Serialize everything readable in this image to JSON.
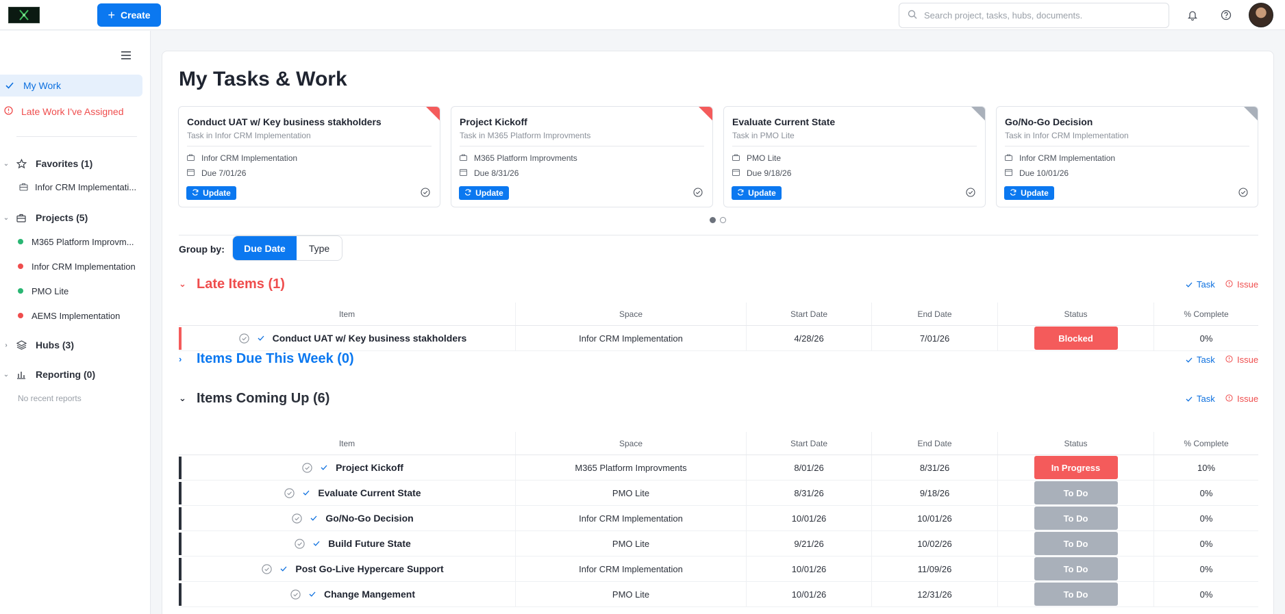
{
  "header": {
    "create_label": "Create",
    "search_placeholder": "Search project, tasks, hubs, documents."
  },
  "sidebar": {
    "my_work": "My Work",
    "late_assigned": "Late Work I've Assigned",
    "favorites": "Favorites (1)",
    "favorite_items": [
      "Infor CRM Implementati..."
    ],
    "projects": "Projects (5)",
    "project_items": [
      {
        "label": "M365 Platform Improvm...",
        "color": "#2ab673"
      },
      {
        "label": "Infor CRM Implementation",
        "color": "#ef4d4d"
      },
      {
        "label": "PMO Lite",
        "color": "#2ab673"
      },
      {
        "label": "AEMS Implementation",
        "color": "#ef4d4d"
      }
    ],
    "hubs": "Hubs (3)",
    "reporting": "Reporting (0)",
    "no_reports": "No recent reports"
  },
  "main": {
    "title": "My Tasks & Work",
    "cards": [
      {
        "title": "Conduct UAT w/ Key business stakholders",
        "subtitle": "Task in Infor CRM Implementation",
        "project": "Infor CRM Implementation",
        "due": "Due 7/01/26",
        "update": "Update",
        "corner": "#f45b5b"
      },
      {
        "title": "Project Kickoff",
        "subtitle": "Task in M365 Platform Improvments",
        "project": "M365 Platform Improvments",
        "due": "Due 8/31/26",
        "update": "Update",
        "corner": "#f45b5b"
      },
      {
        "title": "Evaluate Current State",
        "subtitle": "Task in PMO Lite",
        "project": "PMO Lite",
        "due": "Due 9/18/26",
        "update": "Update",
        "corner": "#a9b0ba"
      },
      {
        "title": "Go/No-Go Decision",
        "subtitle": "Task in Infor CRM Implementation",
        "project": "Infor CRM Implementation",
        "due": "Due 10/01/26",
        "update": "Update",
        "corner": "#a9b0ba"
      }
    ],
    "group_by_label": "Group by:",
    "group_options": [
      "Due Date",
      "Type"
    ],
    "columns": [
      "Item",
      "Space",
      "Start Date",
      "End Date",
      "Status",
      "% Complete"
    ],
    "task_label": "Task",
    "issue_label": "Issue",
    "groups": {
      "late": {
        "title": "Late Items (1)",
        "rows": [
          {
            "item": "Conduct UAT w/ Key business stakholders",
            "space": "Infor CRM Implementation",
            "start": "4/28/26",
            "end": "7/01/26",
            "status": "Blocked",
            "status_color": "#f45b5b",
            "pct": "0%"
          }
        ]
      },
      "week": {
        "title": "Items Due This Week (0)"
      },
      "upcoming": {
        "title": "Items Coming Up (6)",
        "rows": [
          {
            "item": "Project Kickoff",
            "space": "M365 Platform Improvments",
            "start": "8/01/26",
            "end": "8/31/26",
            "status": "In Progress",
            "status_color": "#f45b5b",
            "pct": "10%"
          },
          {
            "item": "Evaluate Current State",
            "space": "PMO Lite",
            "start": "8/31/26",
            "end": "9/18/26",
            "status": "To Do",
            "status_color": "#a9b0ba",
            "pct": "0%"
          },
          {
            "item": "Go/No-Go Decision",
            "space": "Infor CRM Implementation",
            "start": "10/01/26",
            "end": "10/01/26",
            "status": "To Do",
            "status_color": "#a9b0ba",
            "pct": "0%"
          },
          {
            "item": "Build Future State",
            "space": "PMO Lite",
            "start": "9/21/26",
            "end": "10/02/26",
            "status": "To Do",
            "status_color": "#a9b0ba",
            "pct": "0%"
          },
          {
            "item": "Post Go-Live Hypercare Support",
            "space": "Infor CRM Implementation",
            "start": "10/01/26",
            "end": "11/09/26",
            "status": "To Do",
            "status_color": "#a9b0ba",
            "pct": "0%"
          },
          {
            "item": "Change Mangement",
            "space": "PMO Lite",
            "start": "10/01/26",
            "end": "12/31/26",
            "status": "To Do",
            "status_color": "#a9b0ba",
            "pct": "0%"
          }
        ]
      }
    }
  }
}
